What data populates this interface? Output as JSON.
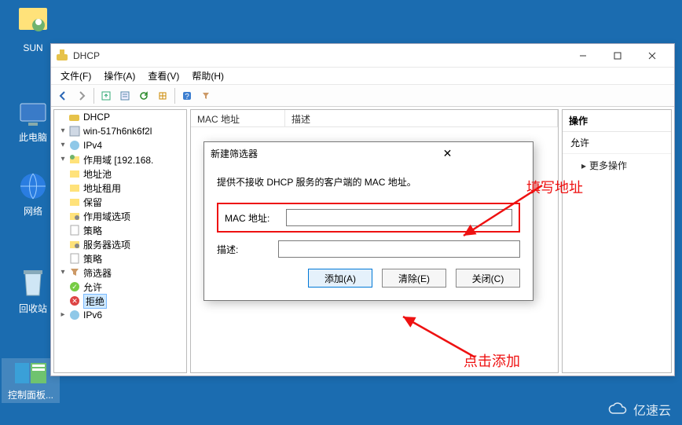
{
  "desktop": {
    "sun": "SUN",
    "pc": "此电脑",
    "network": "网络",
    "recycle": "回收站",
    "cpanel": "控制面板..."
  },
  "titlebar": {
    "title": "DHCP"
  },
  "menu": {
    "file": "文件(F)",
    "action": "操作(A)",
    "view": "查看(V)",
    "help": "帮助(H)"
  },
  "tree": {
    "root": "DHCP",
    "server": "win-517h6nk6f2l",
    "ipv4": "IPv4",
    "scope": "作用域 [192.168.",
    "pool": "地址池",
    "lease": "地址租用",
    "reserve": "保留",
    "scopeopt": "作用域选项",
    "policy": "策略",
    "srvopt": "服务器选项",
    "policy2": "策略",
    "filter": "筛选器",
    "allow": "允许",
    "deny": "拒绝",
    "ipv6": "IPv6"
  },
  "listcols": {
    "mac": "MAC 地址",
    "desc": "描述"
  },
  "actions": {
    "hdr": "操作",
    "section": "允许",
    "more": "更多操作"
  },
  "dialog": {
    "title": "新建筛选器",
    "hint": "提供不接收 DHCP 服务的客户端的 MAC 地址。",
    "maclabel": "MAC 地址:",
    "desclabel": "描述:",
    "add": "添加(A)",
    "clear": "清除(E)",
    "close": "关闭(C)"
  },
  "annotations": {
    "fill": "填写地址",
    "click": "点击添加"
  },
  "watermark": "亿速云"
}
